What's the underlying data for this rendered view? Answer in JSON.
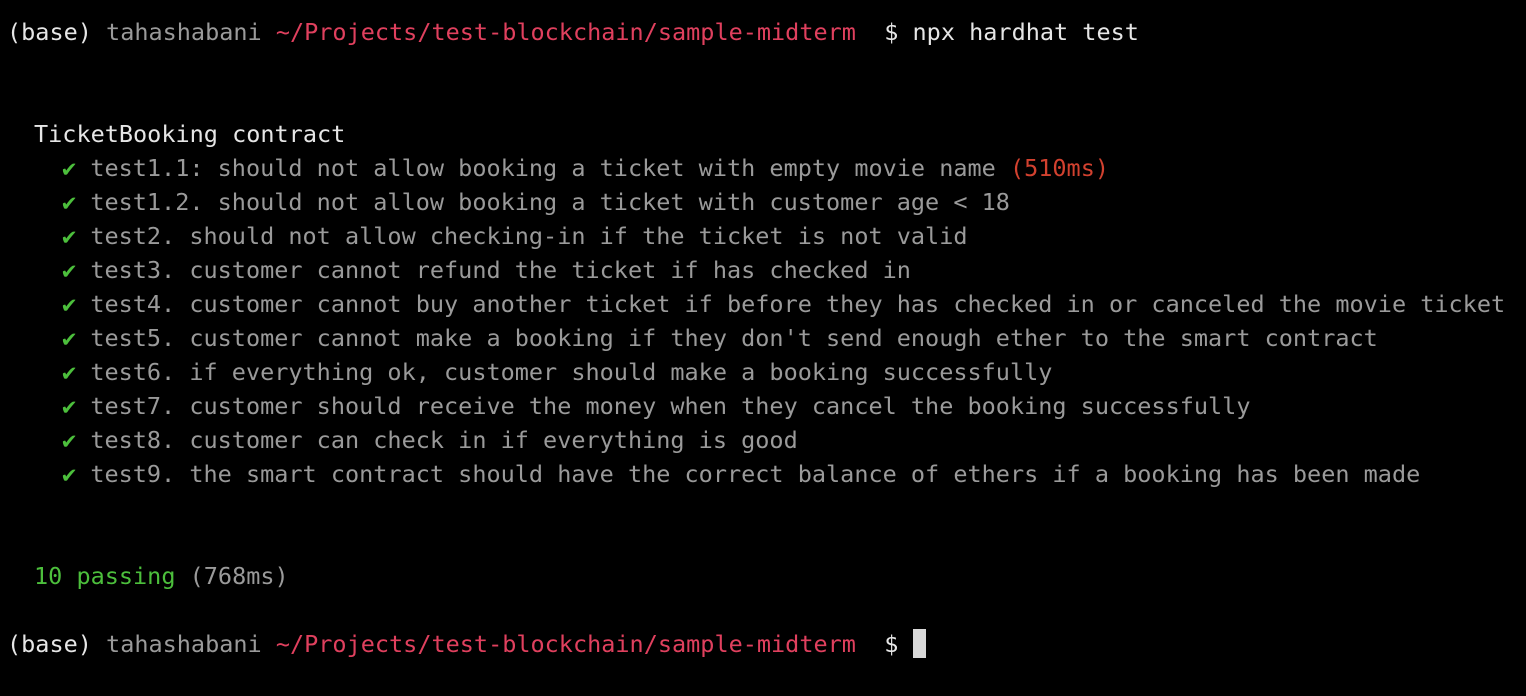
{
  "prompt": {
    "env": "(base)",
    "user": "tahashabani",
    "path": "~/Projects/test-blockchain/sample-midterm",
    "symbol": "$"
  },
  "command": "npx hardhat test",
  "suite": {
    "title": "TicketBooking contract",
    "check_glyph": "✔",
    "tests": [
      {
        "label": "test1.1: should not allow booking a ticket with empty movie name",
        "duration": "(510ms)"
      },
      {
        "label": "test1.2. should not allow booking a ticket with customer age < 18"
      },
      {
        "label": "test2. should not allow checking-in if the ticket is not valid"
      },
      {
        "label": "test3. customer cannot refund the ticket if has checked in"
      },
      {
        "label": "test4. customer cannot buy another ticket if before they has checked in or canceled the movie ticket"
      },
      {
        "label": "test5. customer cannot make a booking if they don't send enough ether to the smart contract"
      },
      {
        "label": "test6. if everything ok, customer should make a booking successfully"
      },
      {
        "label": "test7. customer should receive the money when they cancel the booking successfully"
      },
      {
        "label": "test8. customer can check in if everything is good"
      },
      {
        "label": "test9. the smart contract should have the correct balance of ethers if a booking has been made"
      }
    ]
  },
  "summary": {
    "passing": "10 passing",
    "duration": "(768ms)"
  },
  "colors": {
    "background": "#000000",
    "text": "#e6e6e6",
    "dim": "#9a9a9a",
    "path": "#e0405e",
    "pass_green": "#4cbf3c",
    "slow_red": "#d2412f"
  }
}
